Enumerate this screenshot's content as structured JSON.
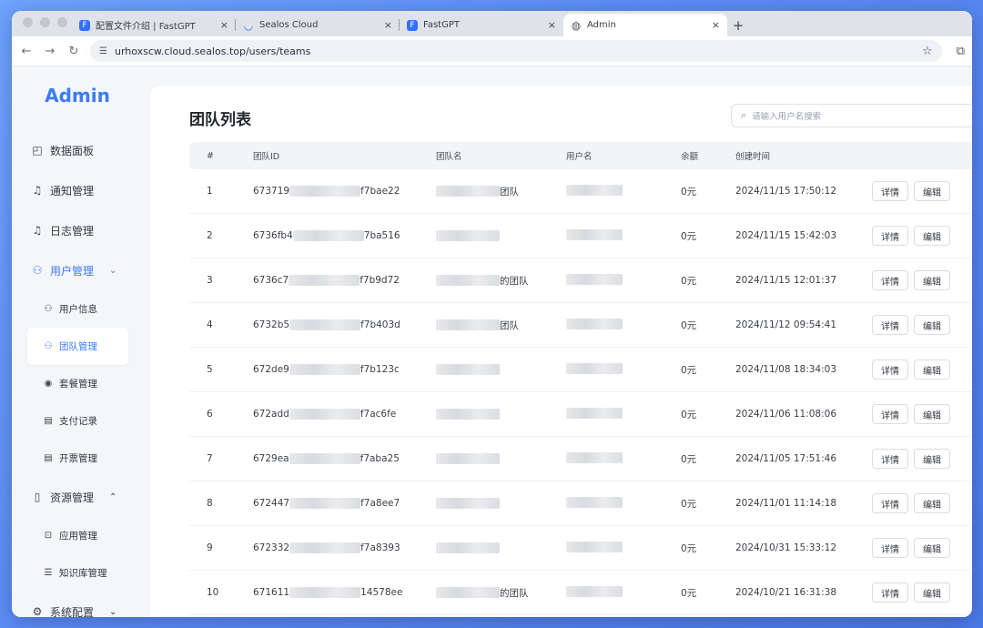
{
  "browser": {
    "tabs": [
      {
        "title": "配置文件介绍 | FastGPT",
        "favicon": "fastgpt-icon",
        "active": false
      },
      {
        "title": "Sealos Cloud",
        "favicon": "sealos-icon",
        "active": false
      },
      {
        "title": "FastGPT",
        "favicon": "fastgpt-icon",
        "active": false
      },
      {
        "title": "Admin",
        "favicon": "globe-icon",
        "active": true
      }
    ],
    "new_tab": "+",
    "close": "×",
    "url": "urhoxscw.cloud.sealos.top/users/teams"
  },
  "sidebar": {
    "brand": "Admin",
    "items": [
      {
        "label": "数据面板",
        "icon": "chart-icon"
      },
      {
        "label": "通知管理",
        "icon": "bell-icon"
      },
      {
        "label": "日志管理",
        "icon": "bell-icon"
      },
      {
        "label": "用户管理",
        "icon": "user-icon",
        "chevron": "⌄"
      },
      {
        "label": "用户信息",
        "icon": "user-info-icon"
      },
      {
        "label": "团队管理",
        "icon": "team-icon"
      },
      {
        "label": "套餐管理",
        "icon": "package-icon"
      },
      {
        "label": "支付记录",
        "icon": "receipt-icon"
      },
      {
        "label": "开票管理",
        "icon": "invoice-icon"
      },
      {
        "label": "资源管理",
        "icon": "book-icon",
        "chevron": "⌃"
      },
      {
        "label": "应用管理",
        "icon": "app-icon"
      },
      {
        "label": "知识库管理",
        "icon": "database-icon"
      },
      {
        "label": "系统配置",
        "icon": "gear-icon",
        "chevron": "⌄"
      }
    ]
  },
  "main": {
    "title": "团队列表",
    "search_placeholder": "请输入用户名搜索",
    "columns": [
      "#",
      "团队ID",
      "团队名",
      "用户名",
      "余额",
      "创建时间"
    ],
    "detail_label": "详情",
    "edit_label": "编辑",
    "rows": [
      {
        "num": "1",
        "id_a": "673719",
        "id_b": "f7bae22",
        "name": "团队",
        "balance": "0元",
        "time": "2024/11/15 17:50:12"
      },
      {
        "num": "2",
        "id_a": "6736fb4",
        "id_b": "7ba516",
        "name": "",
        "balance": "0元",
        "time": "2024/11/15 15:42:03"
      },
      {
        "num": "3",
        "id_a": "6736c7",
        "id_b": "f7b9d72",
        "name": "的团队",
        "balance": "0元",
        "time": "2024/11/15 12:01:37"
      },
      {
        "num": "4",
        "id_a": "6732b5",
        "id_b": "f7b403d",
        "name": "团队",
        "balance": "0元",
        "time": "2024/11/12 09:54:41"
      },
      {
        "num": "5",
        "id_a": "672de9",
        "id_b": "f7b123c",
        "name": "",
        "balance": "0元",
        "time": "2024/11/08 18:34:03"
      },
      {
        "num": "6",
        "id_a": "672add",
        "id_b": "f7ac6fe",
        "name": "",
        "balance": "0元",
        "time": "2024/11/06 11:08:06"
      },
      {
        "num": "7",
        "id_a": "6729ea",
        "id_b": "f7aba25",
        "name": "",
        "balance": "0元",
        "time": "2024/11/05 17:51:46"
      },
      {
        "num": "8",
        "id_a": "672447",
        "id_b": "f7a8ee7",
        "name": "",
        "balance": "0元",
        "time": "2024/11/01 11:14:18"
      },
      {
        "num": "9",
        "id_a": "672332",
        "id_b": "f7a8393",
        "name": "",
        "balance": "0元",
        "time": "2024/10/31 15:33:12"
      },
      {
        "num": "10",
        "id_a": "671611",
        "id_b": "14578ee",
        "name": "的团队",
        "balance": "0元",
        "time": "2024/10/21 16:31:38"
      }
    ]
  }
}
